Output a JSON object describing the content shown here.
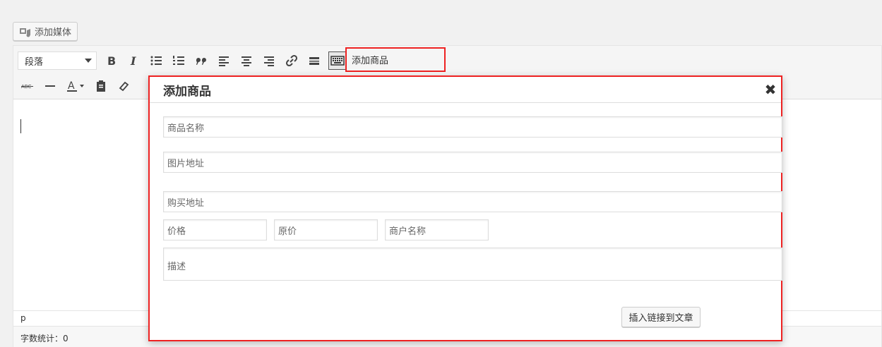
{
  "media": {
    "add_media_label": "添加媒体"
  },
  "toolbar": {
    "format_select_value": "段落",
    "add_product_label": "添加商品"
  },
  "editor": {
    "path_label": "p",
    "word_count_label": "字数统计：0"
  },
  "modal": {
    "title": "添加商品",
    "close_glyph": "✖",
    "fields": {
      "name_placeholder": "商品名称",
      "image_placeholder": "图片地址",
      "buy_placeholder": "购买地址",
      "price_placeholder": "价格",
      "original_price_placeholder": "原价",
      "merchant_placeholder": "商户名称",
      "description_placeholder": "描述"
    },
    "insert_button_label": "插入链接到文章"
  },
  "colors": {
    "highlight_border": "#e22222",
    "toolbar_bg": "#f5f5f5"
  }
}
